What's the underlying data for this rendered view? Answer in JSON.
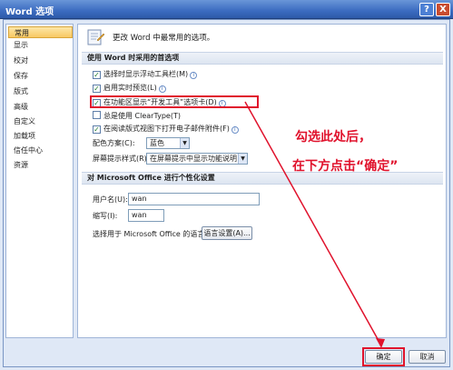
{
  "window": {
    "title": "Word 选项",
    "help_label": "?",
    "close_label": "X"
  },
  "sidebar": {
    "items": [
      {
        "label": "常用",
        "active": true
      },
      {
        "label": "显示"
      },
      {
        "label": "校对"
      },
      {
        "label": "保存"
      },
      {
        "label": "版式"
      },
      {
        "label": "高级"
      },
      {
        "label": "自定义"
      },
      {
        "label": "加载项"
      },
      {
        "label": "信任中心"
      },
      {
        "label": "资源"
      }
    ]
  },
  "header": {
    "text": "更改 Word 中最常用的选项。"
  },
  "section1": {
    "title": "使用 Word 时采用的首选项",
    "options": [
      {
        "label": "选择时显示浮动工具栏(M)",
        "checked": true
      },
      {
        "label": "启用实时预览(L)",
        "checked": true
      },
      {
        "label": "在功能区显示“开发工具”选项卡(D)",
        "checked": true
      },
      {
        "label": "总是使用 ClearType(T)",
        "checked": false
      },
      {
        "label": "在阅读版式视图下打开电子邮件附件(F)",
        "checked": true
      }
    ],
    "color_scheme_label": "配色方案(C):",
    "color_scheme_value": "蓝色",
    "tooltip_style_label": "屏幕提示样式(R):",
    "tooltip_style_value": "在屏幕提示中显示功能说明"
  },
  "section2": {
    "title": "对 Microsoft Office 进行个性化设置",
    "username_label": "用户名(U):",
    "username_value": "wan",
    "initials_label": "缩写(I):",
    "initials_value": "wan",
    "language_label": "选择用于 Microsoft Office 的语言:",
    "language_button": "语言设置(A)..."
  },
  "footer": {
    "ok_label": "确定",
    "cancel_label": "取消"
  },
  "annotation": {
    "line1": "勾选此处后，",
    "line2": "在下方点击“确定”",
    "color": "#e0122c"
  }
}
